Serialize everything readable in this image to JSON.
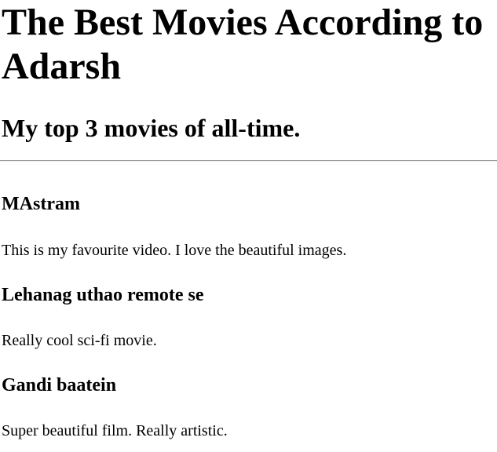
{
  "page": {
    "title": "The Best Movies According to Adarsh",
    "subtitle": "My top 3 movies of all-time."
  },
  "movies": [
    {
      "title": "MAstram",
      "description": "This is my favourite video. I love the beautiful images."
    },
    {
      "title": "Lehanag uthao remote se",
      "description": "Really cool sci-fi movie."
    },
    {
      "title": "Gandi baatein",
      "description": "Super beautiful film. Really artistic."
    }
  ]
}
